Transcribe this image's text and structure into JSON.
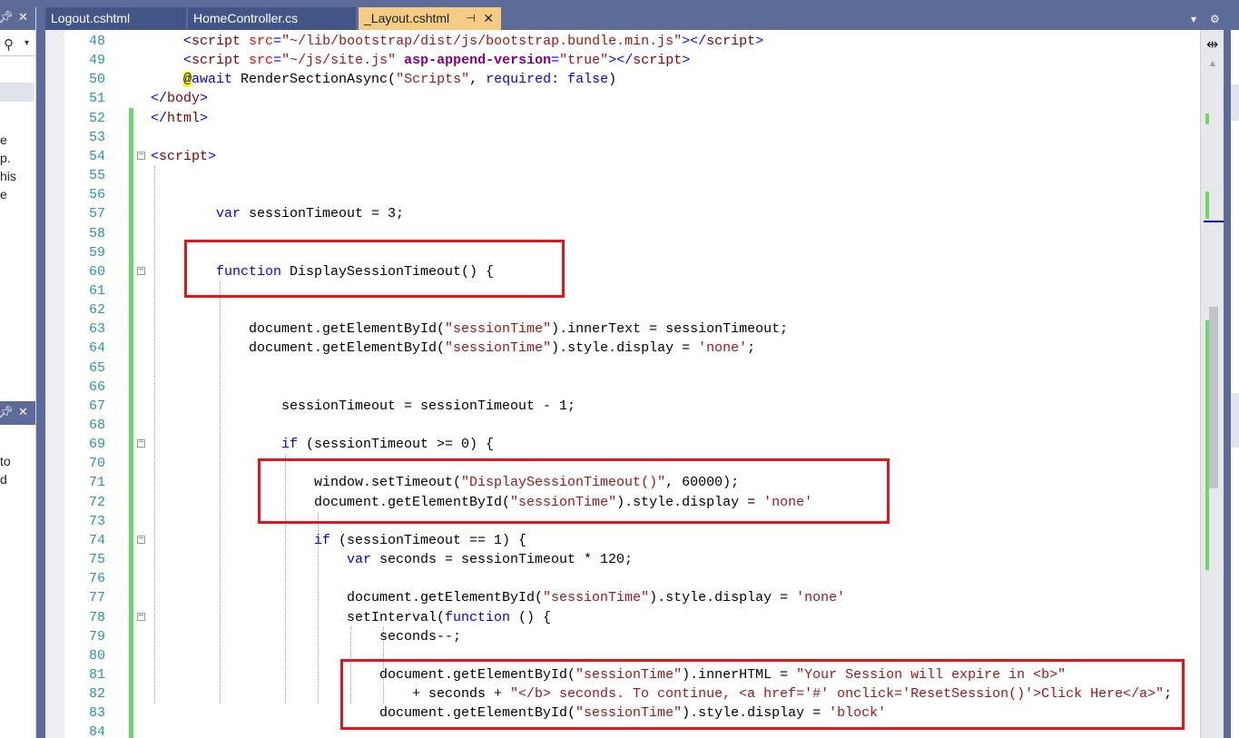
{
  "tabs": [
    {
      "label": "Logout.cshtml",
      "active": false
    },
    {
      "label": "HomeController.cs",
      "active": false
    },
    {
      "label": "_Layout.cshtml",
      "active": true
    }
  ],
  "tab_icons": {
    "pin": "pin-icon",
    "close": "close-icon",
    "dropdown": "chevron-down-icon",
    "settings": "gear-icon"
  },
  "left_pane": {
    "fragments": [
      "e",
      "p.",
      "his",
      "e"
    ],
    "fragments2": [
      "to",
      "d"
    ]
  },
  "colors": {
    "chrome": "#5d6b99",
    "active_tab": "#f5cc84",
    "line_number": "#2b91af",
    "highlight_box": "#e8121a",
    "change_bar": "#6cd66c"
  },
  "code_lines": [
    {
      "n": "48",
      "indent": 1,
      "tokens": [
        {
          "c": "t-bracket",
          "t": "<"
        },
        {
          "c": "t-tag",
          "t": "script"
        },
        {
          "c": "",
          "t": " "
        },
        {
          "c": "t-attr",
          "t": "src"
        },
        {
          "c": "t-bracket",
          "t": "="
        },
        {
          "c": "t-str",
          "t": "\"~/lib/bootstrap/dist/js/bootstrap.bundle.min.js\""
        },
        {
          "c": "t-bracket",
          "t": "></"
        },
        {
          "c": "t-tag",
          "t": "script"
        },
        {
          "c": "t-bracket",
          "t": ">"
        }
      ]
    },
    {
      "n": "49",
      "indent": 1,
      "tokens": [
        {
          "c": "t-bracket",
          "t": "<"
        },
        {
          "c": "t-tag",
          "t": "script"
        },
        {
          "c": "",
          "t": " "
        },
        {
          "c": "t-attr",
          "t": "src"
        },
        {
          "c": "t-bracket",
          "t": "="
        },
        {
          "c": "t-str",
          "t": "\"~/js/site.js\""
        },
        {
          "c": "",
          "t": " "
        },
        {
          "c": "t-bold",
          "t": "asp-append-version"
        },
        {
          "c": "t-bracket",
          "t": "="
        },
        {
          "c": "t-str",
          "t": "\"true\""
        },
        {
          "c": "t-bracket",
          "t": "></"
        },
        {
          "c": "t-tag",
          "t": "script"
        },
        {
          "c": "t-bracket",
          "t": ">"
        }
      ]
    },
    {
      "n": "50",
      "indent": 1,
      "tokens": [
        {
          "c": "t-razor",
          "t": "@"
        },
        {
          "c": "t-kw",
          "t": "await"
        },
        {
          "c": "",
          "t": " RenderSectionAsync("
        },
        {
          "c": "t-str",
          "t": "\"Scripts\""
        },
        {
          "c": "",
          "t": ", "
        },
        {
          "c": "t-gray",
          "t": "required"
        },
        {
          "c": "",
          "t": ": "
        },
        {
          "c": "t-kw",
          "t": "false"
        },
        {
          "c": "",
          "t": ")"
        }
      ]
    },
    {
      "n": "51",
      "indent": 0,
      "tokens": [
        {
          "c": "t-bracket",
          "t": "</"
        },
        {
          "c": "t-tag",
          "t": "body"
        },
        {
          "c": "t-bracket",
          "t": ">"
        }
      ]
    },
    {
      "n": "52",
      "indent": 0,
      "tokens": [
        {
          "c": "t-bracket",
          "t": "</"
        },
        {
          "c": "t-tag",
          "t": "html"
        },
        {
          "c": "t-bracket",
          "t": ">"
        }
      ]
    },
    {
      "n": "53",
      "indent": 0,
      "tokens": []
    },
    {
      "n": "54",
      "indent": 0,
      "fold": true,
      "tokens": [
        {
          "c": "t-bracket",
          "t": "<"
        },
        {
          "c": "t-tag",
          "t": "script"
        },
        {
          "c": "t-bracket",
          "t": ">"
        }
      ]
    },
    {
      "n": "55",
      "indent": 0,
      "tokens": []
    },
    {
      "n": "56",
      "indent": 0,
      "tokens": []
    },
    {
      "n": "57",
      "indent": 2,
      "tokens": [
        {
          "c": "t-kw",
          "t": "var"
        },
        {
          "c": "",
          "t": " sessionTimeout = 3;"
        }
      ]
    },
    {
      "n": "58",
      "indent": 0,
      "tokens": []
    },
    {
      "n": "59",
      "indent": 0,
      "tokens": []
    },
    {
      "n": "60",
      "indent": 2,
      "fold": true,
      "tokens": [
        {
          "c": "t-kw",
          "t": "function"
        },
        {
          "c": "",
          "t": " DisplaySessionTimeout() {"
        }
      ]
    },
    {
      "n": "61",
      "indent": 0,
      "tokens": []
    },
    {
      "n": "62",
      "indent": 0,
      "tokens": []
    },
    {
      "n": "63",
      "indent": 3,
      "tokens": [
        {
          "c": "",
          "t": "document.getElementById("
        },
        {
          "c": "t-str",
          "t": "\"sessionTime\""
        },
        {
          "c": "",
          "t": ").innerText = sessionTimeout;"
        }
      ]
    },
    {
      "n": "64",
      "indent": 3,
      "tokens": [
        {
          "c": "",
          "t": "document.getElementById("
        },
        {
          "c": "t-str",
          "t": "\"sessionTime\""
        },
        {
          "c": "",
          "t": ").style.display = "
        },
        {
          "c": "t-str",
          "t": "'none'"
        },
        {
          "c": "",
          "t": ";"
        }
      ]
    },
    {
      "n": "65",
      "indent": 0,
      "tokens": []
    },
    {
      "n": "66",
      "indent": 0,
      "tokens": []
    },
    {
      "n": "67",
      "indent": 4,
      "tokens": [
        {
          "c": "",
          "t": "sessionTimeout = sessionTimeout - 1;"
        }
      ]
    },
    {
      "n": "68",
      "indent": 0,
      "tokens": []
    },
    {
      "n": "69",
      "indent": 4,
      "fold": true,
      "tokens": [
        {
          "c": "t-kw",
          "t": "if"
        },
        {
          "c": "",
          "t": " (sessionTimeout >= 0) {"
        }
      ]
    },
    {
      "n": "70",
      "indent": 0,
      "tokens": []
    },
    {
      "n": "71",
      "indent": 5,
      "tokens": [
        {
          "c": "",
          "t": "window.setTimeout("
        },
        {
          "c": "t-str",
          "t": "\"DisplaySessionTimeout()\""
        },
        {
          "c": "",
          "t": ", 60000);"
        }
      ]
    },
    {
      "n": "72",
      "indent": 5,
      "tokens": [
        {
          "c": "",
          "t": "document.getElementById("
        },
        {
          "c": "t-str",
          "t": "\"sessionTime\""
        },
        {
          "c": "",
          "t": ").style.display = "
        },
        {
          "c": "t-str",
          "t": "'none'"
        }
      ]
    },
    {
      "n": "73",
      "indent": 0,
      "tokens": []
    },
    {
      "n": "74",
      "indent": 5,
      "fold": true,
      "tokens": [
        {
          "c": "t-kw",
          "t": "if"
        },
        {
          "c": "",
          "t": " (sessionTimeout == 1) {"
        }
      ]
    },
    {
      "n": "75",
      "indent": 6,
      "tokens": [
        {
          "c": "t-kw",
          "t": "var"
        },
        {
          "c": "",
          "t": " seconds = sessionTimeout * 120;"
        }
      ]
    },
    {
      "n": "76",
      "indent": 0,
      "tokens": []
    },
    {
      "n": "77",
      "indent": 6,
      "tokens": [
        {
          "c": "",
          "t": "document.getElementById("
        },
        {
          "c": "t-str",
          "t": "\"sessionTime\""
        },
        {
          "c": "",
          "t": ").style.display = "
        },
        {
          "c": "t-str",
          "t": "'none'"
        }
      ]
    },
    {
      "n": "78",
      "indent": 6,
      "fold": true,
      "tokens": [
        {
          "c": "",
          "t": "setInterval("
        },
        {
          "c": "t-kw",
          "t": "function"
        },
        {
          "c": "",
          "t": " () {"
        }
      ]
    },
    {
      "n": "79",
      "indent": 7,
      "tokens": [
        {
          "c": "",
          "t": "seconds--;"
        }
      ]
    },
    {
      "n": "80",
      "indent": 0,
      "tokens": []
    },
    {
      "n": "81",
      "indent": 7,
      "tokens": [
        {
          "c": "",
          "t": "document.getElementById("
        },
        {
          "c": "t-str",
          "t": "\"sessionTime\""
        },
        {
          "c": "",
          "t": ").innerHTML = "
        },
        {
          "c": "t-str",
          "t": "\"Your Session will expire in <b>\""
        }
      ]
    },
    {
      "n": "82",
      "indent": 8,
      "tokens": [
        {
          "c": "",
          "t": "+ seconds + "
        },
        {
          "c": "t-str",
          "t": "\"</b> seconds. To continue, <a href='#' onclick='ResetSession()'>Click Here</a>\""
        },
        {
          "c": "",
          "t": ";"
        }
      ]
    },
    {
      "n": "83",
      "indent": 7,
      "tokens": [
        {
          "c": "",
          "t": "document.getElementById("
        },
        {
          "c": "t-str",
          "t": "\"sessionTime\""
        },
        {
          "c": "",
          "t": ").style.display = "
        },
        {
          "c": "t-str",
          "t": "'block'"
        }
      ]
    },
    {
      "n": "84",
      "indent": 0,
      "tokens": []
    }
  ]
}
